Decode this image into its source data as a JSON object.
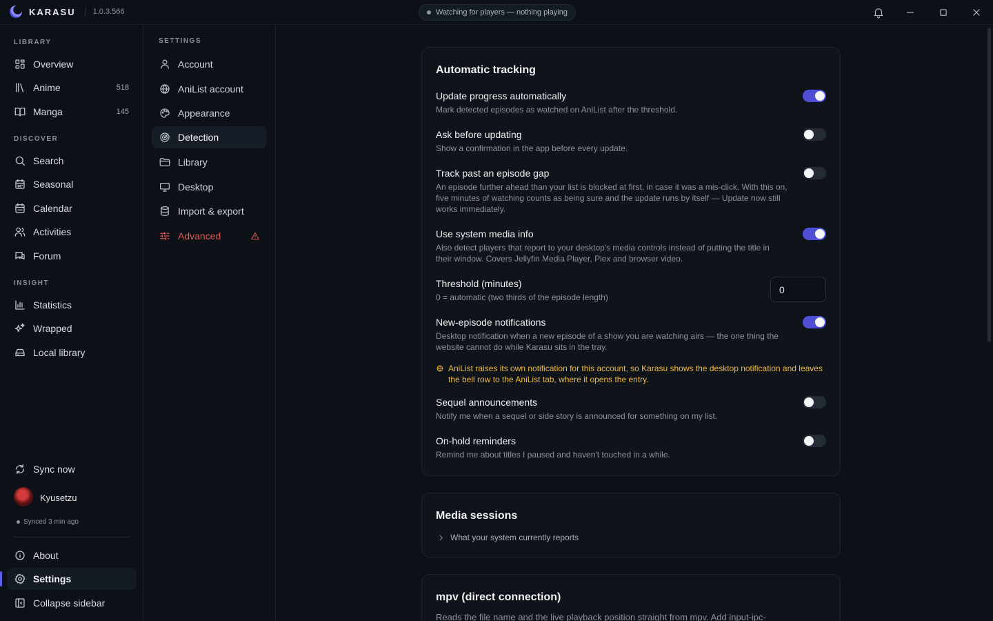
{
  "titlebar": {
    "brand": "KARASU",
    "version": "1.0.3.566",
    "status": "Watching for players — nothing playing"
  },
  "sidebar": {
    "sections": {
      "library": "LIBRARY",
      "discover": "DISCOVER",
      "insight": "INSIGHT"
    },
    "library_items": [
      {
        "label": "Overview",
        "icon": "grid-icon"
      },
      {
        "label": "Anime",
        "icon": "books-icon",
        "count": "518"
      },
      {
        "label": "Manga",
        "icon": "book-open-icon",
        "count": "145"
      }
    ],
    "discover_items": [
      {
        "label": "Search",
        "icon": "search-icon"
      },
      {
        "label": "Seasonal",
        "icon": "calendar-week-icon"
      },
      {
        "label": "Calendar",
        "icon": "calendar-icon"
      },
      {
        "label": "Activities",
        "icon": "users-icon"
      },
      {
        "label": "Forum",
        "icon": "chat-icon"
      }
    ],
    "insight_items": [
      {
        "label": "Statistics",
        "icon": "bar-chart-icon"
      },
      {
        "label": "Wrapped",
        "icon": "sparkles-icon"
      },
      {
        "label": "Local library",
        "icon": "hard-drive-icon"
      }
    ],
    "sync_label": "Sync now",
    "user": {
      "name": "Kyusetzu",
      "synced": "Synced 3 min ago"
    },
    "bottom_items": [
      {
        "label": "About",
        "icon": "info-icon"
      },
      {
        "label": "Settings",
        "icon": "gear-icon",
        "active": true
      },
      {
        "label": "Collapse sidebar",
        "icon": "sidebar-collapse-icon"
      }
    ]
  },
  "settings_nav": {
    "title": "SETTINGS",
    "items": [
      {
        "label": "Account",
        "icon": "user-icon"
      },
      {
        "label": "AniList account",
        "icon": "globe-icon"
      },
      {
        "label": "Appearance",
        "icon": "palette-icon"
      },
      {
        "label": "Detection",
        "icon": "radar-icon",
        "active": true
      },
      {
        "label": "Library",
        "icon": "folder-icon"
      },
      {
        "label": "Desktop",
        "icon": "monitor-icon"
      },
      {
        "label": "Import & export",
        "icon": "database-icon"
      },
      {
        "label": "Advanced",
        "icon": "sliders-icon",
        "warning": true
      }
    ]
  },
  "tracking": {
    "title": "Automatic tracking",
    "settings": [
      {
        "title": "Update progress automatically",
        "desc": "Mark detected episodes as watched on AniList after the threshold.",
        "on": true
      },
      {
        "title": "Ask before updating",
        "desc": "Show a confirmation in the app before every update.",
        "on": false
      },
      {
        "title": "Track past an episode gap",
        "desc": "An episode further ahead than your list is blocked at first, in case it was a mis-click. With this on, five minutes of watching counts as being sure and the update runs by itself — Update now still works immediately.",
        "on": false
      },
      {
        "title": "Use system media info",
        "desc": "Also detect players that report to your desktop's media controls instead of putting the title in their window. Covers Jellyfin Media Player, Plex and browser video.",
        "on": true
      },
      {
        "title": "Threshold (minutes)",
        "desc": "0 = automatic (two thirds of the episode length)",
        "value": "0"
      },
      {
        "title": "New-episode notifications",
        "desc": "Desktop notification when a new episode of a show you are watching airs — the one thing the website cannot do while Karasu sits in the tray.",
        "on": true
      },
      {
        "title": "Sequel announcements",
        "desc": "Notify me when a sequel or side story is announced for something on my list.",
        "on": false
      },
      {
        "title": "On-hold reminders",
        "desc": "Remind me about titles I paused and haven't touched in a while.",
        "on": false
      }
    ],
    "notice": "AniList raises its own notification for this account, so Karasu shows the desktop notification and leaves the bell row to the AniList tab, where it opens the entry."
  },
  "media_sessions": {
    "title": "Media sessions",
    "disclosure": "What your system currently reports"
  },
  "mpv": {
    "title": "mpv (direct connection)",
    "desc": "Reads the file name and the live playback position straight from mpv. Add input-ipc-"
  },
  "colors": {
    "accent": "#4f4fd6",
    "warning": "#f0b93b",
    "danger": "#e0584f"
  }
}
